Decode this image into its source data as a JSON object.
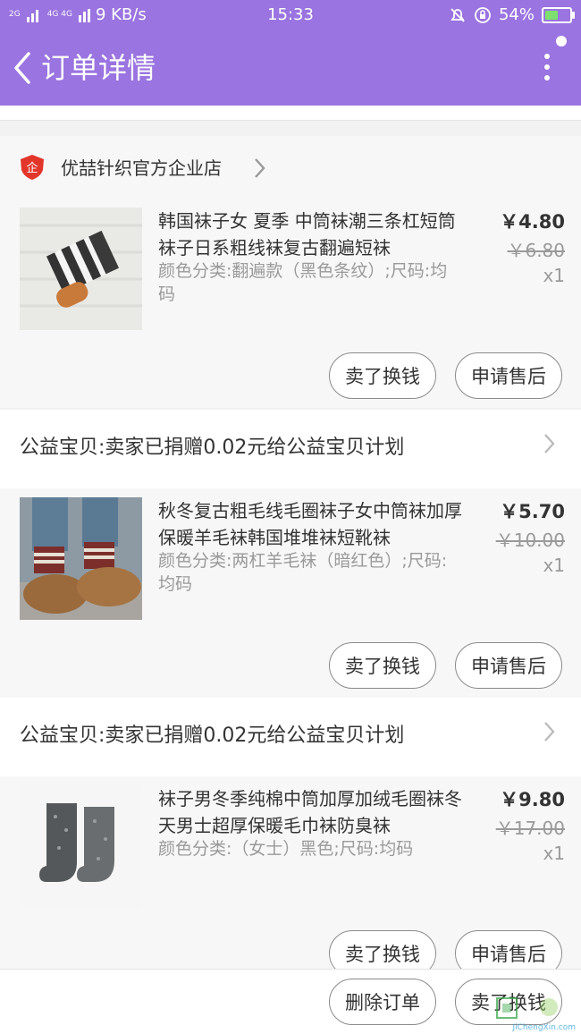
{
  "status_bar": {
    "network_left": "2G",
    "network_mid": "4G 4G",
    "speed": "9 KB/s",
    "time": "15:33",
    "battery": "54%",
    "battery_level": 0.54
  },
  "nav": {
    "title": "订单详情",
    "back_icon": "chevron-left-icon",
    "more_icon": "more-vertical-icon"
  },
  "store": {
    "badge_icon": "enterprise-shield-icon",
    "badge_text": "企",
    "name": "优喆针织官方企业店"
  },
  "items": [
    {
      "title": "韩国袜子女 夏季 中筒袜潮三条杠短筒袜子日系粗线袜复古翻遍短袜",
      "spec": "颜色分类:翻遍款（黑色条纹）;尺码:均码",
      "price": "￥4.80",
      "original_price": "￥6.80",
      "qty": "x1",
      "sell_label": "卖了换钱",
      "after_sale_label": "申请售后"
    },
    {
      "title": "秋冬复古粗毛线毛圈袜子女中筒袜加厚保暖羊毛袜韩国堆堆袜短靴袜",
      "spec": "颜色分类:两杠羊毛袜（暗红色）;尺码:均码",
      "price": "￥5.70",
      "original_price": "￥10.00",
      "qty": "x1",
      "sell_label": "卖了换钱",
      "after_sale_label": "申请售后"
    },
    {
      "title": "袜子男冬季纯棉中筒加厚加绒毛圈袜冬天男士超厚保暖毛巾袜防臭袜",
      "spec": "颜色分类:（女士）黑色;尺码:均码",
      "price": "￥9.80",
      "original_price": "￥17.00",
      "qty": "x1",
      "sell_label": "卖了换钱",
      "after_sale_label": "申请售后"
    }
  ],
  "charity": [
    {
      "text": "公益宝贝:卖家已捐赠0.02元给公益宝贝计划"
    },
    {
      "text": "公益宝贝:卖家已捐赠0.02元给公益宝贝计划"
    }
  ],
  "bottom_bar": {
    "delete_label": "删除订单",
    "sell_label": "卖了换钱"
  },
  "watermark": {
    "text": "JiChengXin.com"
  }
}
